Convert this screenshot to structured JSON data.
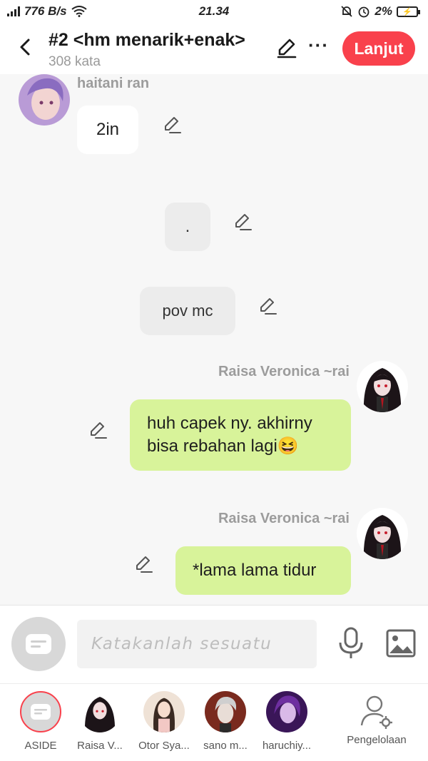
{
  "status_bar": {
    "speed": "776 B/s",
    "time": "21.34",
    "battery": "2%"
  },
  "header": {
    "title": "#2 <hm menarik+enak>",
    "subtitle": "308 kata",
    "next_label": "Lanjut"
  },
  "messages": [
    {
      "sender": "haitani ran",
      "text": "2in",
      "side": "left"
    },
    {
      "sender": "",
      "text": ".",
      "side": "center"
    },
    {
      "sender": "",
      "text": "pov mc",
      "side": "center"
    },
    {
      "sender": "Raisa Veronica ~rai",
      "text": "huh capek ny. akhirny bisa rebahan lagi😆",
      "side": "right"
    },
    {
      "sender": "Raisa Veronica ~rai",
      "text": "*lama lama tidur",
      "side": "right"
    }
  ],
  "input": {
    "placeholder": "Katakanlah sesuatu"
  },
  "tabs": [
    {
      "label": "ASIDE"
    },
    {
      "label": "Raisa V..."
    },
    {
      "label": "Otor Sya..."
    },
    {
      "label": "sano m..."
    },
    {
      "label": "haruchiy..."
    },
    {
      "label": "Pengelolaan"
    }
  ],
  "colors": {
    "accent": "#f9414c",
    "bubble_green": "#d8f39a",
    "bubble_grey": "#ececec"
  }
}
